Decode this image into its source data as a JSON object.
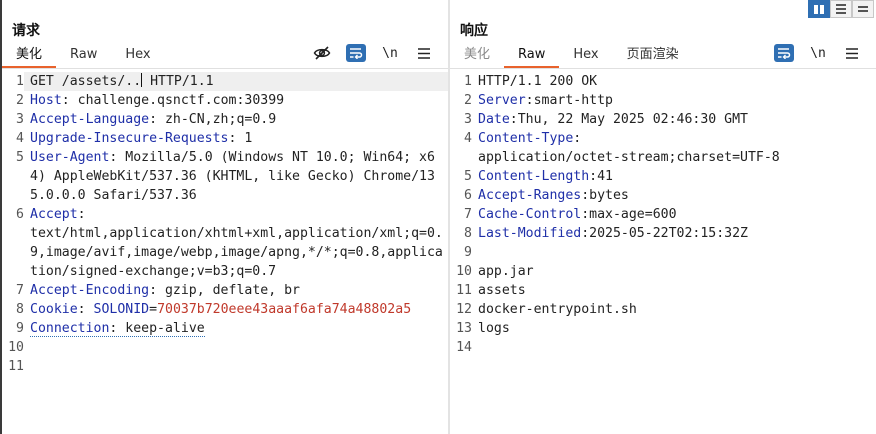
{
  "request": {
    "title": "请求",
    "tabs": [
      "美化",
      "Raw",
      "Hex"
    ],
    "active_tab": "美化",
    "lines": [
      {
        "num": "1",
        "before": "GET /assets/..",
        "after": " HTTP/1.1"
      },
      {
        "num": "2",
        "key": "Host",
        "sep": ": ",
        "val": "challenge.qsnctf.com:30399"
      },
      {
        "num": "3",
        "key": "Accept-Language",
        "sep": ": ",
        "val": "zh-CN,zh;q=0.9"
      },
      {
        "num": "4",
        "key": "Upgrade-Insecure-Requests",
        "sep": ": ",
        "val": "1"
      },
      {
        "num": "5",
        "key": "User-Agent",
        "sep": ": ",
        "val": "Mozilla/5.0 (Windows NT 10.0; Win64; x64) AppleWebKit/537.36 (KHTML, like Gecko) Chrome/135.0.0.0 Safari/537.36"
      },
      {
        "num": "6",
        "key": "Accept",
        "sep": ":",
        "val": "text/html,application/xhtml+xml,application/xml;q=0.9,image/avif,image/webp,image/apng,*/*;q=0.8,application/signed-exchange;v=b3;q=0.7"
      },
      {
        "num": "7",
        "key": "Accept-Encoding",
        "sep": ": ",
        "val": "gzip, deflate, br"
      },
      {
        "num": "8",
        "key": "Cookie",
        "sep": ": ",
        "ckey": "SOLONID",
        "ceq": "=",
        "cval": "70037b720eee43aaaf6afa74a48802a5"
      },
      {
        "num": "9",
        "key": "Connection",
        "sep": ": ",
        "val": "keep-alive"
      },
      {
        "num": "10"
      },
      {
        "num": "11"
      }
    ]
  },
  "response": {
    "title": "响应",
    "tabs": [
      "美化",
      "Raw",
      "Hex",
      "页面渲染"
    ],
    "active_tab": "Raw",
    "lines": [
      {
        "num": "1",
        "text": "HTTP/1.1 200 OK"
      },
      {
        "num": "2",
        "key": "Server",
        "sep": ":",
        "val": "smart-http"
      },
      {
        "num": "3",
        "key": "Date",
        "sep": ":",
        "val": "Thu, 22 May 2025 02:46:30 GMT"
      },
      {
        "num": "4",
        "key": "Content-Type",
        "sep": ":",
        "val": "application/octet-stream;charset=UTF-8"
      },
      {
        "num": "5",
        "key": "Content-Length",
        "sep": ":",
        "val": "41"
      },
      {
        "num": "6",
        "key": "Accept-Ranges",
        "sep": ":",
        "val": "bytes"
      },
      {
        "num": "7",
        "key": "Cache-Control",
        "sep": ":",
        "val": "max-age=600"
      },
      {
        "num": "8",
        "key": "Last-Modified",
        "sep": ":",
        "val": "2025-05-22T02:15:32Z"
      },
      {
        "num": "9"
      },
      {
        "num": "10",
        "text": "app.jar"
      },
      {
        "num": "11",
        "text": "assets"
      },
      {
        "num": "12",
        "text": "docker-entrypoint.sh"
      },
      {
        "num": "13",
        "text": "logs"
      },
      {
        "num": "14"
      }
    ]
  },
  "toolbar": {
    "newline_label": "\\n"
  },
  "icons": {
    "hide": "eye-slash-icon",
    "wrap": "word-wrap-icon",
    "menu": "hamburger-menu-icon",
    "layout_side": "split-vertical-icon",
    "layout_stack": "split-horizontal-icon"
  },
  "colors": {
    "header_key": "#1f2fa8",
    "cookie_value": "#c0392b",
    "accent_tab": "#e8622c",
    "button_blue": "#2f6fb3"
  }
}
